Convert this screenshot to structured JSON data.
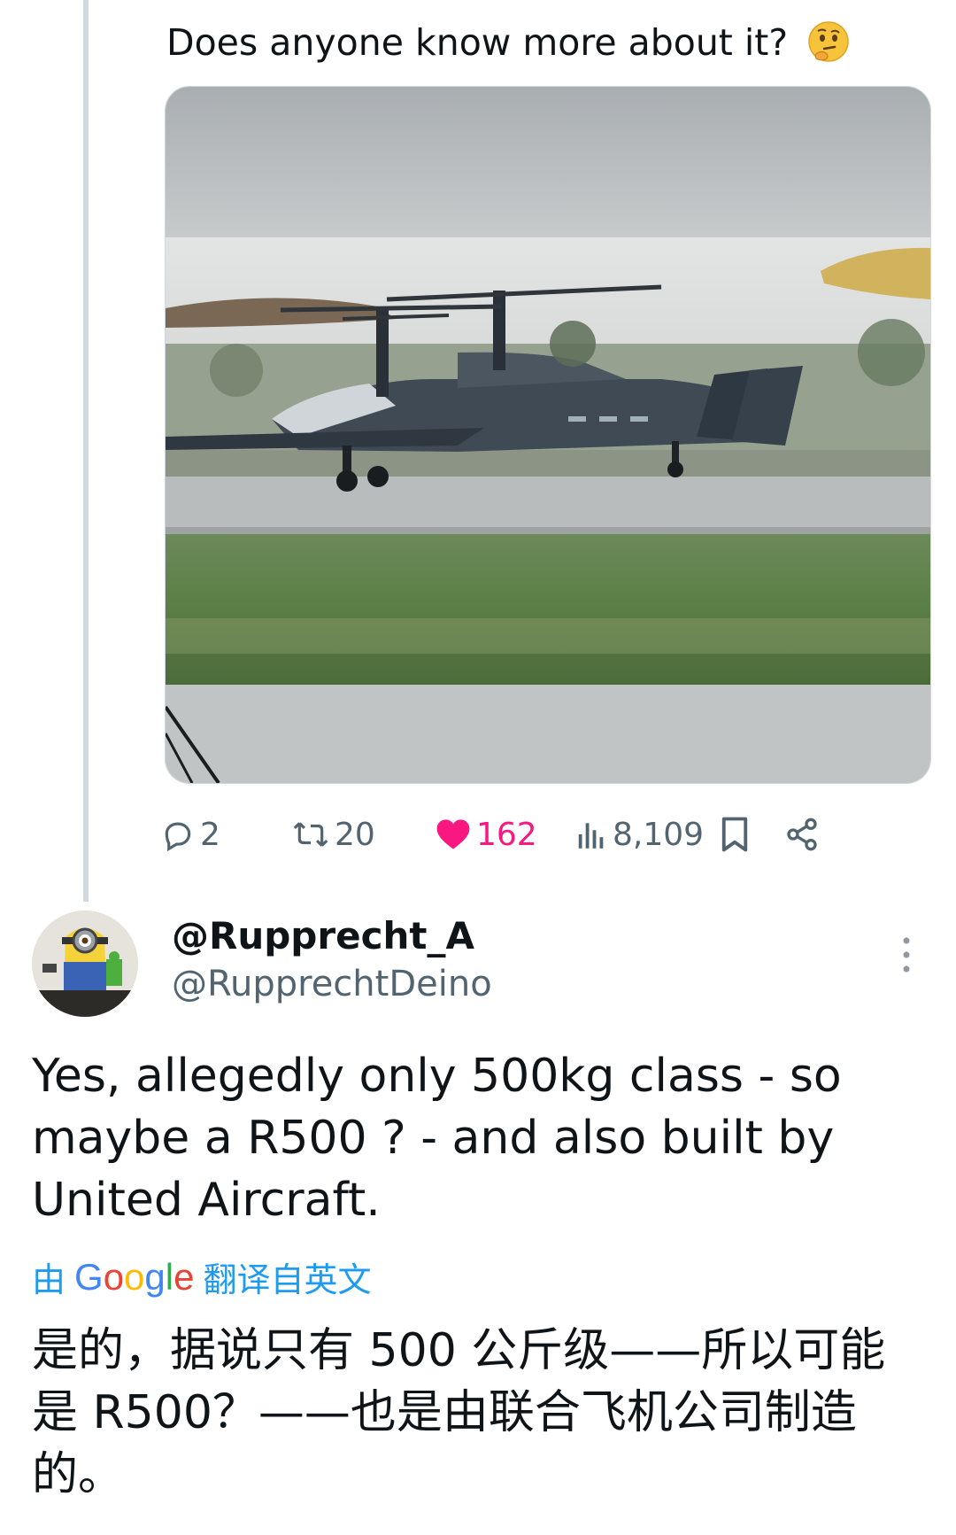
{
  "original_tweet": {
    "text": "Does anyone know more about it?",
    "emoji_icon": "thinking-face-emoji",
    "media_alt": "photo-of-coaxial-rotor-aircraft-on-runway"
  },
  "actions": {
    "replies": "2",
    "reposts": "20",
    "likes": "162",
    "views": "8,109"
  },
  "reply": {
    "display_name": "@Rupprecht_A",
    "handle": "@RupprechtDeino",
    "text": "Yes, allegedly only 500kg class - so maybe a R500 ? - and also built by United Aircraft.",
    "translate_prefix": "由",
    "translate_suffix": "翻译自英文",
    "translated_text": "是的，据说只有 500 公斤级——所以可能是 R500？——也是由联合飞机公司制造的。"
  },
  "colors": {
    "like": "#f91880",
    "link": "#1d9bf0",
    "muted": "#536471"
  }
}
